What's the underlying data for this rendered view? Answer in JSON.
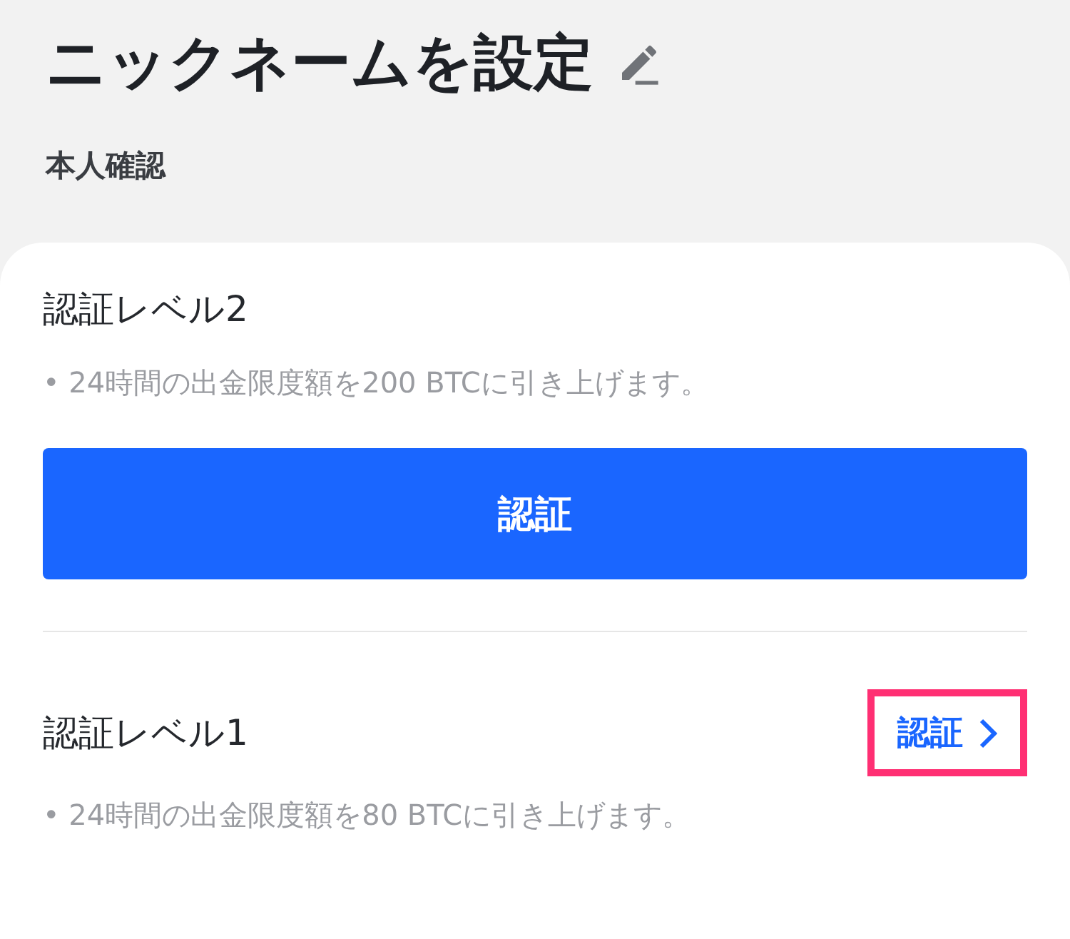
{
  "title": "ニックネームを設定",
  "subtitle": "本人確認",
  "levels": [
    {
      "name": "認証レベル2",
      "benefit": "• 24時間の出金限度額を200 BTCに引き上げます。",
      "kind": "button",
      "action": "認証",
      "highlighted": false
    },
    {
      "name": "認証レベル1",
      "benefit": "• 24時間の出金限度額を80 BTCに引き上げます。",
      "kind": "link",
      "action": "認証",
      "highlighted": true
    }
  ]
}
